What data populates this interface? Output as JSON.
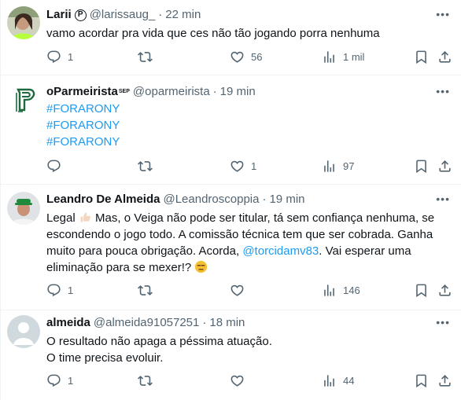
{
  "posts": [
    {
      "display_name": "Larii",
      "badge": "P",
      "handle": "@larissaug_",
      "time": "22 min",
      "text_lines": [
        "vamo acordar pra vida que ces não tão jogando porra nenhuma"
      ],
      "replies": "1",
      "reposts": "",
      "likes": "56",
      "views": "1 mil"
    },
    {
      "display_name": "oParmeirista",
      "name_suffix": "SEP",
      "handle": "@oparmeirista",
      "time": "19 min",
      "text_lines": [
        "#FORARONY",
        "#FORARONY",
        "#FORARONY"
      ],
      "replies": "",
      "reposts": "",
      "likes": "1",
      "views": "97"
    },
    {
      "display_name": "Leandro De Almeida",
      "handle": "@Leandroscoppia",
      "time": "19 min",
      "text_line1_a": "Legal",
      "text_line1_b": " Mas, o Veiga não pode ser titular, tá sem confiança nenhuma, se",
      "text_line2": "escondendo o jogo todo. A comissão técnica tem que ser cobrada. Ganha",
      "text_line3_a": "muito para pouca obrigação. Acorda, ",
      "mention": "@torcidamv83",
      "text_line3_b": ". Vai esperar uma",
      "text_line4": "eliminação para se mexer!?",
      "replies": "1",
      "reposts": "",
      "likes": "",
      "views": "146"
    },
    {
      "display_name": "almeida",
      "handle": "@almeida91057251",
      "time": "18 min",
      "text_lines": [
        "O resultado não apaga a péssima atuação.",
        "O time precisa evoluir."
      ],
      "replies": "1",
      "reposts": "",
      "likes": "",
      "views": "44"
    }
  ],
  "colors": {
    "text": "#0f1419",
    "secondary": "#536471",
    "link": "#1d9bf0",
    "divider": "#eff3f4"
  },
  "icons": [
    "reply-icon",
    "repost-icon",
    "like-icon",
    "views-icon",
    "bookmark-icon",
    "share-icon",
    "more-icon",
    "verified-badge"
  ]
}
